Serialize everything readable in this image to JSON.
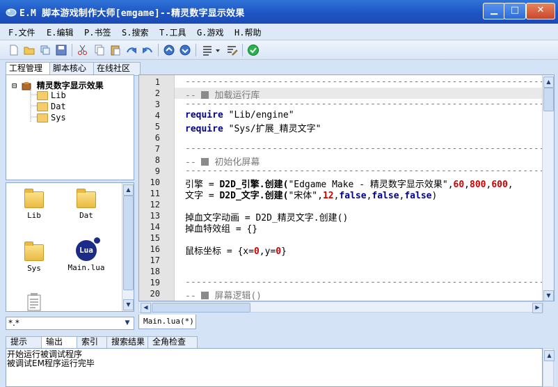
{
  "window": {
    "title": "E.M 脚本游戏制作大师[emgame]--精灵数字显示效果",
    "min_glyph": "▁",
    "max_glyph": "□",
    "close_glyph": "✕"
  },
  "menu": [
    {
      "key": "F.",
      "label": "文件"
    },
    {
      "key": "E.",
      "label": "编辑"
    },
    {
      "key": "P.",
      "label": "书签"
    },
    {
      "key": "S.",
      "label": "搜索"
    },
    {
      "key": "T.",
      "label": "工具"
    },
    {
      "key": "G.",
      "label": "游戏"
    },
    {
      "key": "H.",
      "label": "帮助"
    }
  ],
  "toolbar": {
    "icons": [
      "new-file-icon",
      "open-folder-icon",
      "copy-window-icon",
      "save-icon",
      "cut-icon",
      "copy-icon",
      "paste-icon",
      "redo-icon",
      "undo-icon",
      "arrow-up-icon",
      "arrow-down-icon",
      "format-icon",
      "dropdown-icon",
      "edit-icon",
      "run-check-icon"
    ]
  },
  "left_tabs": [
    "工程管理",
    "脚本核心",
    "在线社区"
  ],
  "tree": {
    "toggle": "⊟",
    "root": "精灵数字显示效果",
    "children": [
      "Lib",
      "Dat",
      "Sys"
    ]
  },
  "file_grid": {
    "items": [
      {
        "name": "Lib",
        "type": "folder"
      },
      {
        "name": "Dat",
        "type": "folder"
      },
      {
        "name": "Sys",
        "type": "folder"
      },
      {
        "name": "Main.lua",
        "type": "lua",
        "badge": "Lua"
      }
    ]
  },
  "filter": {
    "value": "*.*",
    "arrow": "▼"
  },
  "editor": {
    "line_numbers": [
      "1",
      "2",
      "3",
      "4",
      "5",
      "6",
      "7",
      "8",
      "9",
      "10",
      "11",
      "12",
      "13",
      "14",
      "15",
      "16",
      "17",
      "18",
      "19",
      "20"
    ],
    "rule": "-------------------------------------------------------------------",
    "section_prefix": "-- ",
    "sections": [
      "加载运行库",
      "初始化屏幕",
      "屏幕逻辑()"
    ],
    "require_kw": "require",
    "requires": [
      "\"Lib/engine\"",
      "\"Sys/扩展_精灵文字\""
    ],
    "line10": {
      "lhs": "引擎 = ",
      "call": "D2D_引擎.创建(",
      "str": "\"Edgame Make - 精灵数字显示效果\"",
      "sep": ",",
      "n1": "60",
      "n2": "800",
      "n3": "600",
      "tail": ","
    },
    "line11": {
      "lhs": "文字 = ",
      "call": "D2D_文字.创建(",
      "str": "\"宋体\"",
      "sep": ",",
      "n": "12",
      "b1": "false",
      "b2": "false",
      "b3": "false",
      "close": ")"
    },
    "line13": "掉血文字动画 = D2D_精灵文字.创建()",
    "line14": "掉血特效组 = {}",
    "line16": {
      "lhs": "鼠标坐标 = {x=",
      "x": "0",
      "mid": ",y=",
      "y": "0",
      "close": "}"
    }
  },
  "doc_tab": "Main.lua(*)",
  "bottom_tabs": [
    "提示",
    "输出",
    "索引",
    "搜索结果",
    "全角检查"
  ],
  "output_lines": [
    "开始运行被调试程序",
    "被调试EM程序运行完毕"
  ]
}
